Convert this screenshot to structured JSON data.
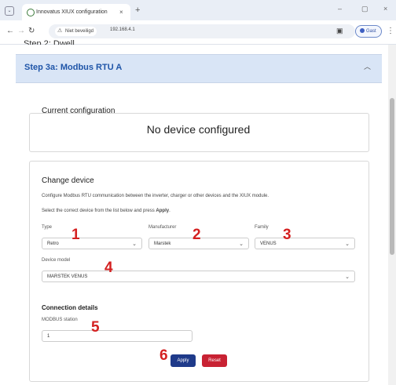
{
  "browser": {
    "tab_title": "Innovatus XIUX configuration",
    "tab_close": "×",
    "new_tab": "+",
    "not_secure": "Niet beveiligd",
    "url": "192.168.4.1",
    "profile": "Gast",
    "window_controls": [
      "–",
      "▢",
      "×"
    ]
  },
  "page": {
    "step2_title": "Step 2: Dwell",
    "step3a_title": "Step 3a: Modbus RTU A",
    "current_config": {
      "title": "Current configuration",
      "status": "No device configured"
    },
    "change_device": {
      "title": "Change device",
      "desc1": "Configure Modbus RTU communication between the inverter, charger or other devices and the XIUX module.",
      "desc2_pre": "Select the correct device from the list below and press ",
      "desc2_bold": "Apply",
      "desc2_post": ".",
      "type": {
        "label": "Type",
        "value": "Retro"
      },
      "manufacturer": {
        "label": "Manufacturer",
        "value": "Marstek"
      },
      "family": {
        "label": "Family",
        "value": "VENUS"
      },
      "device_model": {
        "label": "Device model",
        "value": "MARSTEK VENUS"
      }
    },
    "connection": {
      "title": "Connection details",
      "station_label": "MODBUS station",
      "station_value": "1"
    },
    "buttons": {
      "apply": "Apply",
      "reset": "Reset"
    },
    "markers": [
      "1",
      "2",
      "3",
      "4",
      "5",
      "6"
    ]
  },
  "colors": {
    "accordion_bg": "#d9e5f6",
    "accordion_text": "#1f55a8",
    "apply": "#1f3a8a",
    "reset": "#c82233",
    "marker": "#d42020"
  }
}
